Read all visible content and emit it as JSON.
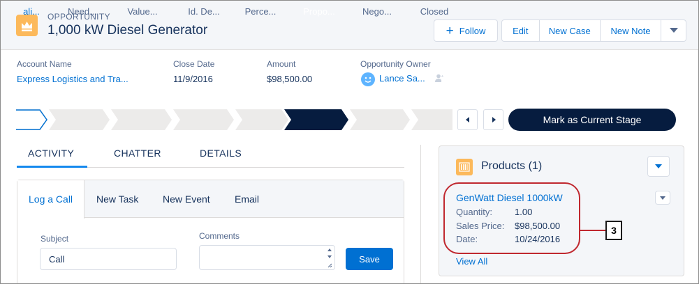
{
  "header": {
    "object_label": "OPPORTUNITY",
    "title": "1,000 kW Diesel Generator",
    "follow_label": "Follow",
    "actions": [
      "Edit",
      "New Case",
      "New Note"
    ]
  },
  "highlights": {
    "account_name": {
      "label": "Account Name",
      "value": "Express Logistics and Tra..."
    },
    "close_date": {
      "label": "Close Date",
      "value": "11/9/2016"
    },
    "amount": {
      "label": "Amount",
      "value": "$98,500.00"
    },
    "owner": {
      "label": "Opportunity Owner",
      "value": "Lance Sa..."
    }
  },
  "path": {
    "stages": [
      "ali...",
      "Need...",
      "Value...",
      "Id. De...",
      "Perce...",
      "Propo...",
      "Nego...",
      "Closed"
    ],
    "current_index": 5,
    "mark_button": "Mark as Current Stage"
  },
  "tabs": [
    "ACTIVITY",
    "CHATTER",
    "DETAILS"
  ],
  "activity": {
    "tabs": [
      "Log a Call",
      "New Task",
      "New Event",
      "Email"
    ],
    "subject_label": "Subject",
    "subject_value": "Call",
    "comments_label": "Comments",
    "save_label": "Save"
  },
  "products": {
    "title": "Products (1)",
    "item": {
      "name": "GenWatt Diesel 1000kW",
      "quantity_label": "Quantity:",
      "quantity": "1.00",
      "price_label": "Sales Price:",
      "price": "$98,500.00",
      "date_label": "Date:",
      "date": "10/24/2016"
    },
    "view_all": "View All"
  },
  "callout": {
    "number": "3"
  },
  "colors": {
    "brand": "#0070d2",
    "path_current": "#061c3f",
    "object_icon": "#fcb95b",
    "callout": "#c0282f"
  }
}
